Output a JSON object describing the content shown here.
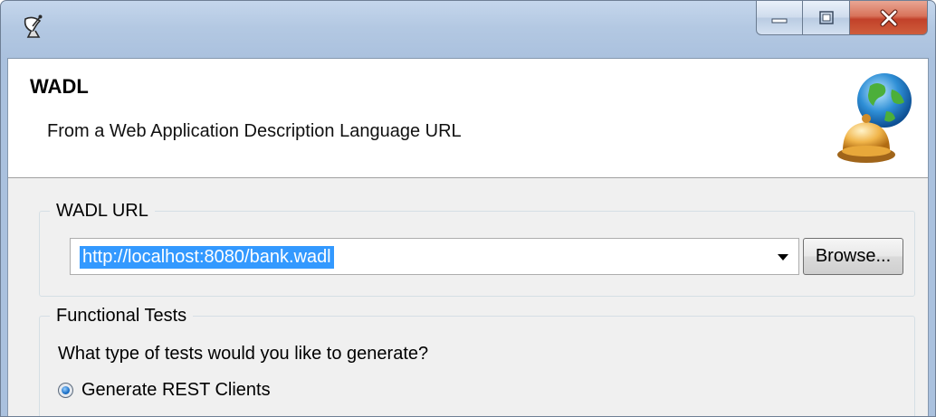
{
  "window": {
    "title": "",
    "icons": {
      "app": "satellite-dish-icon",
      "minimize": "minimize-icon",
      "maximize": "maximize-icon",
      "close": "close-icon"
    },
    "colors": {
      "close_button": "#c2412a",
      "frame": "#aac1de"
    }
  },
  "header": {
    "title": "WADL",
    "description": "From a Web Application Description Language URL",
    "logo": "globe-bell-icon"
  },
  "wadl_group": {
    "label": "WADL URL",
    "url_combo": {
      "value": "http://localhost:8080/bank.wadl",
      "selected": true
    },
    "browse_label": "Browse..."
  },
  "tests_group": {
    "label": "Functional Tests",
    "question": "What type of tests would you like to generate?",
    "options": [
      {
        "label": "Generate REST Clients",
        "checked": true
      }
    ]
  },
  "colors": {
    "selection": "#3399ff",
    "dialog_bg": "#f0f0f0"
  }
}
